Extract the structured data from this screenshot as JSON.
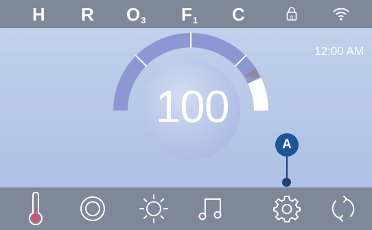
{
  "status_bar": {
    "indicators": [
      {
        "label": "H",
        "sub": ""
      },
      {
        "label": "R",
        "sub": ""
      },
      {
        "label": "O",
        "sub": "3"
      },
      {
        "label": "F",
        "sub": "1"
      },
      {
        "label": "C",
        "sub": ""
      }
    ],
    "icons": [
      "lock-icon",
      "wifi-icon"
    ]
  },
  "clock": "12:00 AM",
  "temperature": {
    "value": "100",
    "gauge_level": 0.86
  },
  "callout": {
    "label": "A"
  },
  "bottom_nav": {
    "items": [
      "thermometer-icon",
      "target-icon",
      "sun-icon",
      "music-note-icon",
      "gear-icon",
      "refresh-icon"
    ]
  },
  "colors": {
    "bar": "#7f8898",
    "gauge_fill": "#8d97d3",
    "gauge_empty": "#ffffff",
    "callout": "#1c5698",
    "thermometer_red": "#d4546a"
  }
}
